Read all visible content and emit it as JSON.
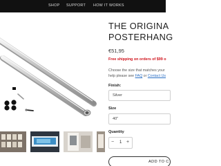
{
  "nav": {
    "items": [
      "SHOP",
      "SUPPORT",
      "HOW IT WORKS"
    ]
  },
  "product": {
    "title_line1": "THE ORIGINA",
    "title_line2": "POSTERHANG",
    "price": "€51,95",
    "shipping": "Free shipping on orders of $99 o",
    "desc_line1": "Choose the size that matches your",
    "desc_prefix": "help please see ",
    "faq_link": "FAQ",
    "desc_or": " or ",
    "contact_link": "Contact Us"
  },
  "finish": {
    "label": "Finish:",
    "value": "Silver"
  },
  "size": {
    "label": "Size",
    "value": "40\""
  },
  "quantity": {
    "label": "Quantity",
    "minus": "−",
    "value": "1",
    "plus": "+"
  },
  "cart": {
    "add_label": "ADD TO C"
  }
}
